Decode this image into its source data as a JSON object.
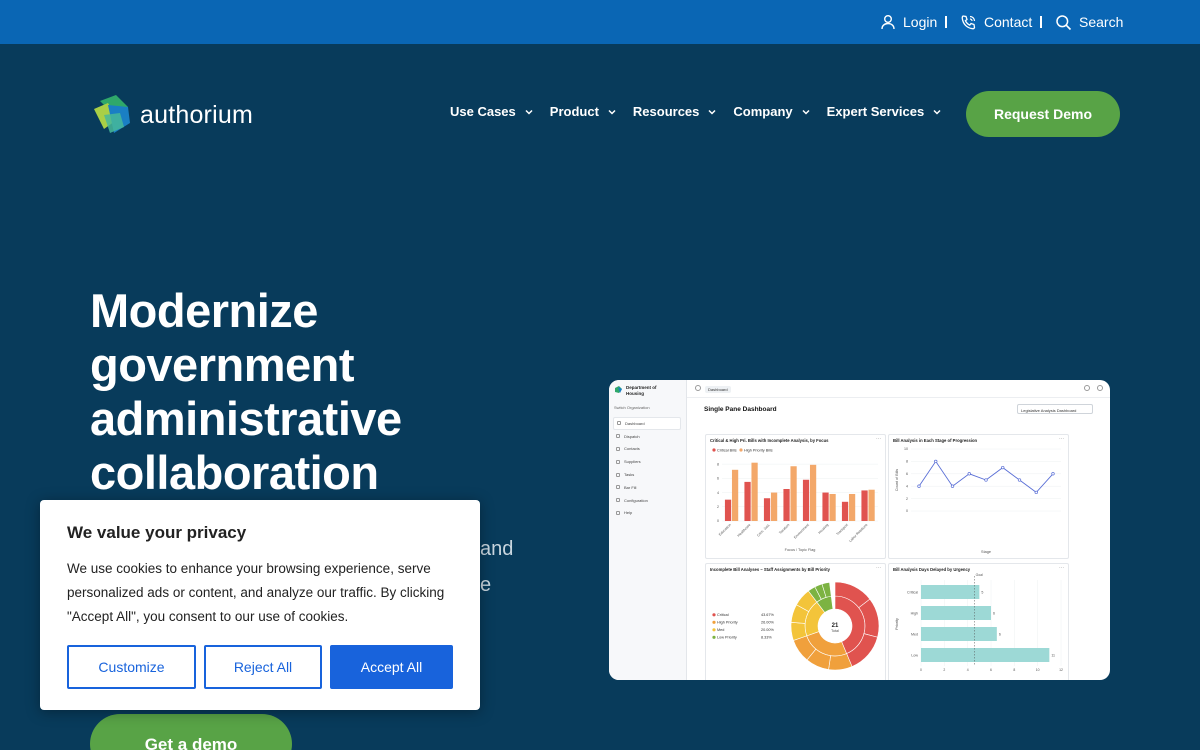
{
  "topbar": {
    "login": "Login",
    "contact": "Contact",
    "search": "Search"
  },
  "brand": {
    "name": "authorium"
  },
  "nav": {
    "items": [
      {
        "label": "Use Cases"
      },
      {
        "label": "Product"
      },
      {
        "label": "Resources"
      },
      {
        "label": "Company"
      },
      {
        "label": "Expert Services"
      }
    ],
    "cta": "Request Demo"
  },
  "hero": {
    "title_lines": [
      "Modernize",
      "government",
      "administrative",
      "collaboration"
    ],
    "subtitle_visible_fragments": [
      "and",
      "e"
    ],
    "cta": "Get a demo"
  },
  "dashboard": {
    "org_name_lines": [
      "Department of",
      "Housing"
    ],
    "switch_label": "Switch Organization",
    "sidebar": [
      "Dashboard",
      "Dispatch",
      "Contacts",
      "Suppliers",
      "Tasks",
      "Bar Fill",
      "Configuration",
      "Help"
    ],
    "breadcrumb": "Dashboard",
    "title": "Single Pane Dashboard",
    "select_value": "Legislative Analysis Dashboard",
    "cards": {
      "bar": {
        "title": "Critical & High Pri. Bills with Incomplete Analysis, by Focus",
        "legend": [
          "Critical Bills",
          "High Priority Bills"
        ],
        "categories": [
          "Education",
          "Healthcare",
          "Crim. Just.",
          "Taxation",
          "Environment",
          "Housing",
          "Transport",
          "Labor Relations"
        ],
        "critical": [
          3,
          5.5,
          3.2,
          4.5,
          5.8,
          4,
          2.7,
          4.3
        ],
        "high": [
          7.2,
          8.2,
          4,
          7.7,
          7.9,
          3.8,
          3.8,
          4.4
        ],
        "yticks": [
          "0",
          "2",
          "4",
          "6",
          "8"
        ],
        "xlabel": "Focus / Topic Flag"
      },
      "line": {
        "title": "Bill Analysis in Each Stage of Progression",
        "values": [
          4,
          8,
          4,
          6,
          5,
          7,
          5,
          3,
          6
        ],
        "yticks": [
          "0",
          "2",
          "4",
          "6",
          "8",
          "10"
        ],
        "ylabel": "Count of Bills",
        "xlabel": "Stage"
      },
      "sunburst": {
        "title": "Incomplete Bill Analyses – Staff Assignments by Bill Priority",
        "legend": [
          {
            "label": "Critical",
            "pct": "43.67%"
          },
          {
            "label": "High Priority",
            "pct": "26.00%"
          },
          {
            "label": "Med",
            "pct": "20.00%"
          },
          {
            "label": "Low Priority",
            "pct": "8.33%"
          }
        ],
        "center_value": "21",
        "center_label": "Total"
      },
      "hbar": {
        "title": "Bill Analysis Days Delayed by Urgency",
        "categories": [
          "Critical",
          "High",
          "Med",
          "Low"
        ],
        "values": [
          5,
          6,
          6.5,
          11
        ],
        "labels": [
          "5",
          "6",
          "6",
          "11"
        ],
        "ylabel": "Priority",
        "goal_label": "Goal"
      }
    }
  },
  "cookie": {
    "title": "We value your privacy",
    "body": "We use cookies to enhance your browsing experience, serve personalized ads or content, and analyze our traffic. By clicking \"Accept All\", you consent to our use of cookies.",
    "customize": "Customize",
    "reject": "Reject All",
    "accept": "Accept All"
  },
  "colors": {
    "topbar": "#0a66b4",
    "background": "#083b5b",
    "green": "#58a346",
    "cookie_blue": "#1863dc"
  }
}
